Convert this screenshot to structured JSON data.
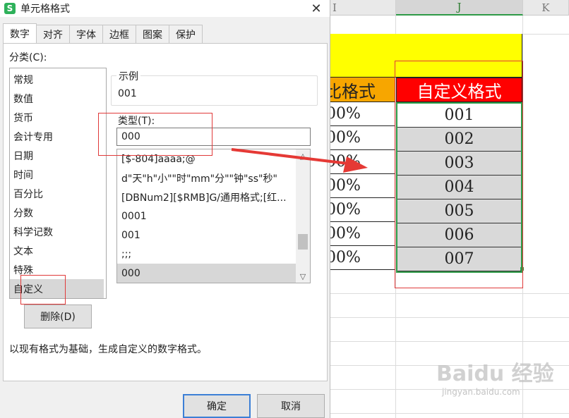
{
  "dialog": {
    "title": "单元格格式",
    "app_icon_letter": "S",
    "close_glyph": "✕",
    "tabs": [
      "数字",
      "对齐",
      "字体",
      "边框",
      "图案",
      "保护"
    ],
    "category_label": "分类(C):",
    "categories": [
      "常规",
      "数值",
      "货币",
      "会计专用",
      "日期",
      "时间",
      "百分比",
      "分数",
      "科学记数",
      "文本",
      "特殊",
      "自定义"
    ],
    "selected_category": "自定义",
    "sample_legend": "示例",
    "sample_value": "001",
    "type_label": "类型(T):",
    "type_value": "000",
    "formats": [
      "[$-804]aaaa;@",
      "d\"天\"h\"小\"\"时\"mm\"分\"\"钟\"ss\"秒\"",
      "[DBNum2][$RMB]G/通用格式;[红...",
      "0001",
      "001",
      ";;;",
      "000"
    ],
    "selected_format": "000",
    "delete_button": "删除(D)",
    "description": "以现有格式为基础，生成自定义的数字格式。",
    "ok_button": "确定",
    "cancel_button": "取消"
  },
  "sheet": {
    "columns": [
      "I",
      "J",
      "K"
    ],
    "selected_column": "J",
    "header_left_partial": "比格式",
    "header_custom": "自定义格式",
    "percent_values": [
      "00%",
      "00%",
      "00%",
      "00%",
      "00%",
      "00%",
      "00%"
    ],
    "custom_values": [
      "001",
      "002",
      "003",
      "004",
      "005",
      "006",
      "007"
    ],
    "watermark": "Baidu 经验",
    "watermark_sub": "jingyan.baidu.com"
  },
  "colors": {
    "yellow": "#ffff00",
    "orange": "#f7a600",
    "red_header": "#ff0000",
    "selection_green": "#2e9a47",
    "annotation_red": "#e03a3a"
  }
}
